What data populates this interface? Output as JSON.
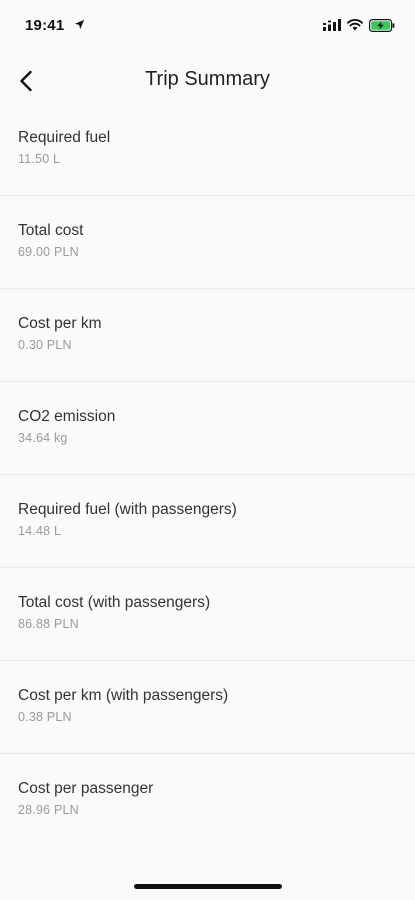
{
  "status_bar": {
    "time": "19:41"
  },
  "header": {
    "title": "Trip Summary"
  },
  "rows": [
    {
      "label": "Required fuel",
      "value": "11.50 L"
    },
    {
      "label": "Total cost",
      "value": "69.00 PLN"
    },
    {
      "label": "Cost per km",
      "value": "0.30 PLN"
    },
    {
      "label": "CO2 emission",
      "value": "34.64 kg"
    },
    {
      "label": "Required fuel (with passengers)",
      "value": "14.48 L"
    },
    {
      "label": "Total cost (with passengers)",
      "value": "86.88 PLN"
    },
    {
      "label": "Cost per km (with passengers)",
      "value": "0.38 PLN"
    },
    {
      "label": "Cost per passenger",
      "value": "28.96 PLN"
    }
  ],
  "colors": {
    "background": "#fafafa",
    "divider": "#e9e9e9",
    "value_text": "#9a9a9a",
    "battery_fill": "#34c759"
  },
  "icons": {
    "back": "chevron-left-icon",
    "location": "location-arrow-icon",
    "signal": "cellular-signal-icon",
    "wifi": "wifi-icon",
    "battery": "battery-charging-icon"
  }
}
